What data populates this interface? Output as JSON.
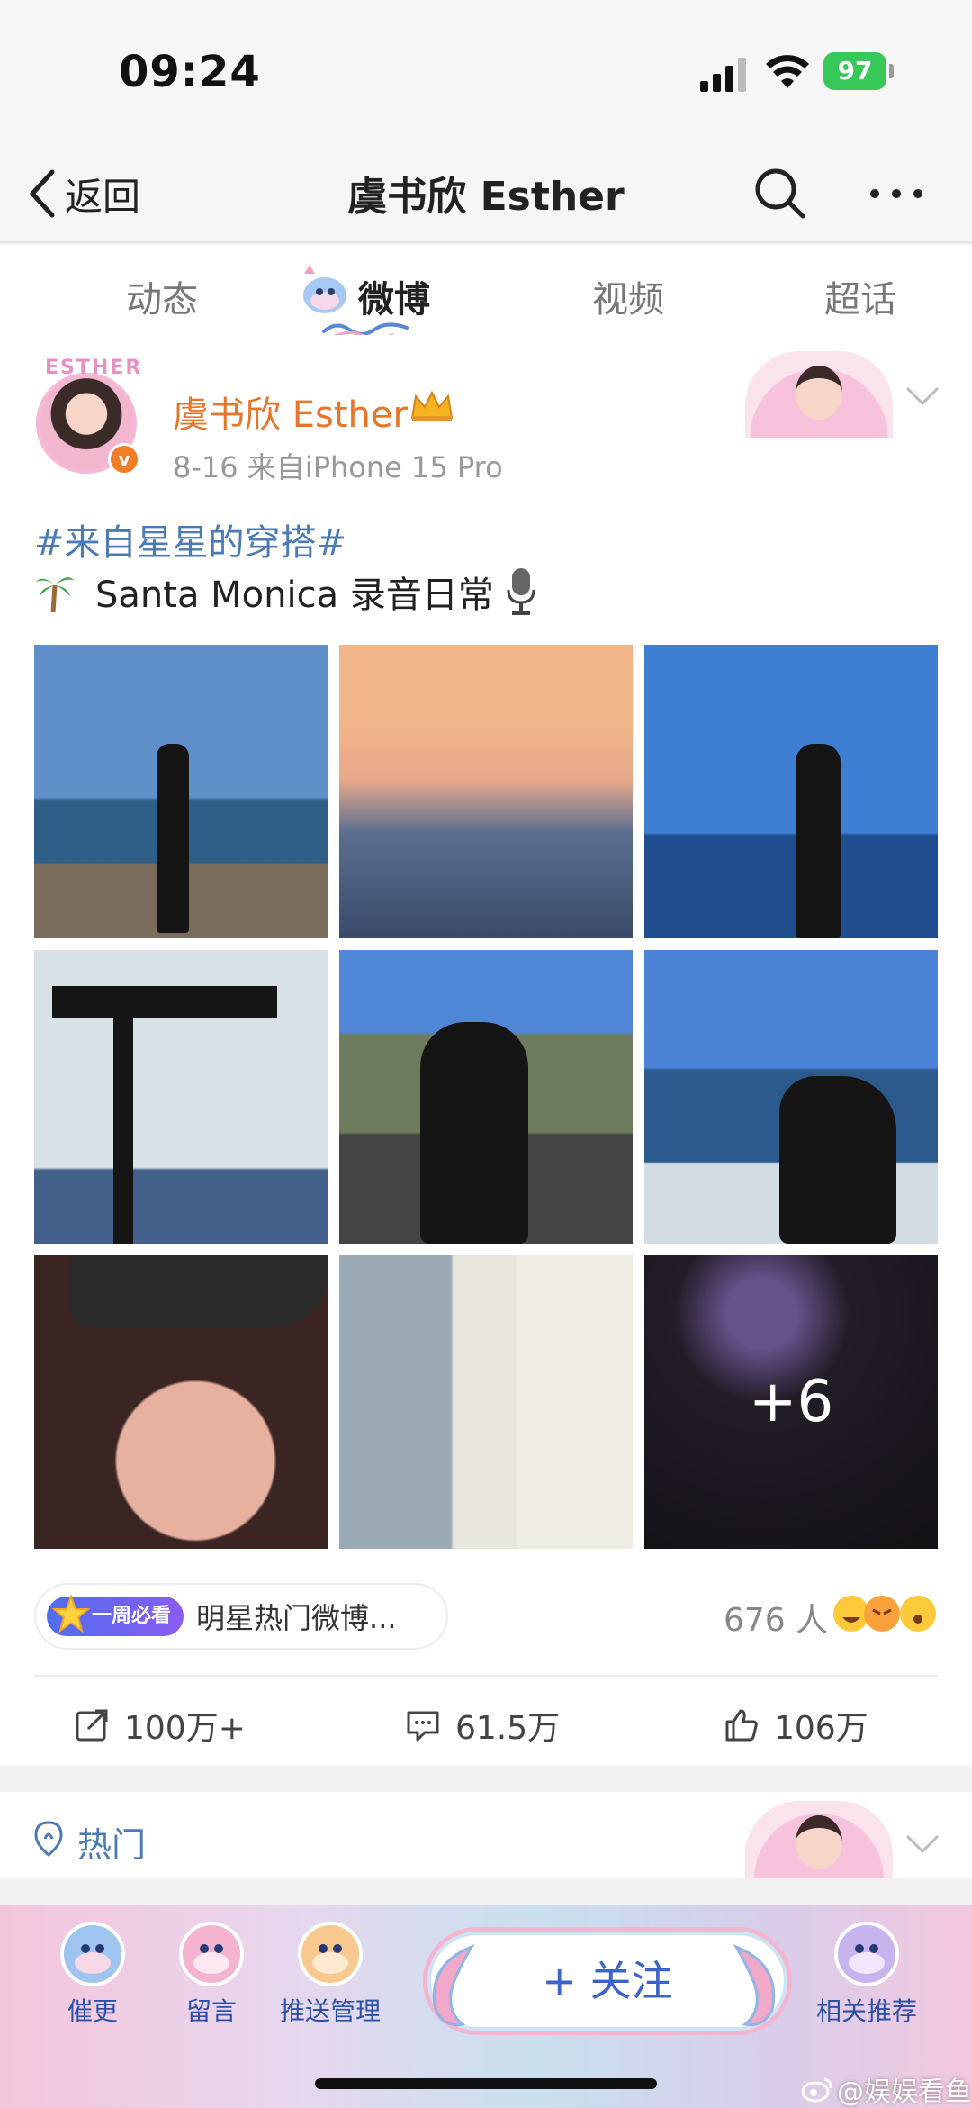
{
  "status_bar": {
    "time": "09:24",
    "battery": "97"
  },
  "nav": {
    "back_label": "返回",
    "title": "虞书欣 Esther"
  },
  "tabs": [
    {
      "label": "动态",
      "active": false
    },
    {
      "label": "微博",
      "active": true
    },
    {
      "label": "视频",
      "active": false
    },
    {
      "label": "超话",
      "active": false
    }
  ],
  "post": {
    "avatar_text": "ESTHER",
    "author": "虞书欣 Esther",
    "meta": "8-16  来自iPhone 15 Pro",
    "hashtag": "#来自星星的穿搭#",
    "text": "Santa Monica 录音日常",
    "more_photos": "+6",
    "hot_badge": "一周必看",
    "hot_text": "明星热门微博...",
    "likes_people": "676 人",
    "actions": {
      "repost": "100万+",
      "comments": "61.5万",
      "likes": "106万"
    }
  },
  "hot_section": {
    "label": "热门"
  },
  "bottom_bar": {
    "items": [
      "催更",
      "留言",
      "推送管理",
      "相关推荐"
    ],
    "follow": "+ 关注"
  },
  "watermark": "@娱娱看鱼",
  "colors": {
    "accent_orange": "#e8752a",
    "link_blue": "#4b7bb6",
    "follow_blue": "#3b63c9"
  }
}
